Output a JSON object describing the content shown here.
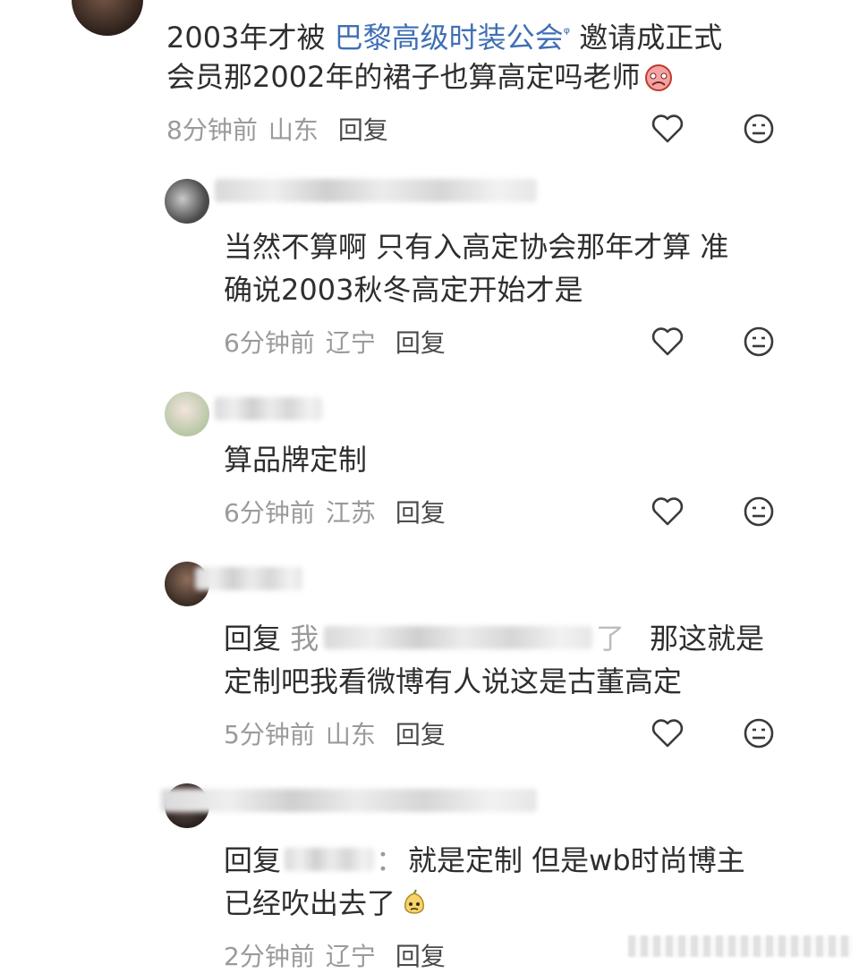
{
  "comments": [
    {
      "text_pre": "2003年才被 ",
      "link": "巴黎高级时装公会",
      "link_mark": "ᵠ",
      "text_post": " 邀请成正式",
      "line2": "会员那2002年的裙子也算高定吗老师",
      "time": "8分钟前",
      "location": "山东",
      "reply": "回复"
    },
    {
      "line1": "当然不算啊 只有入高定协会那年才算 准",
      "line2": "确说2003秋冬高定开始才是",
      "time": "6分钟前",
      "location": "辽宁",
      "reply": "回复"
    },
    {
      "line1": "算品牌定制",
      "time": "6分钟前",
      "location": "江苏",
      "reply": "回复"
    },
    {
      "reply_prefix": "回复",
      "mention_start": "我",
      "mention_end": "了",
      "line1_tail": "那这就是",
      "line2": "定制吧我看微博有人说这是古董高定",
      "time": "5分钟前",
      "location": "山东",
      "reply": "回复"
    },
    {
      "reply_prefix": "回复",
      "colon": "：",
      "line1_tail": "就是定制 但是wb时尚博主",
      "line2": "已经吹出去了",
      "time": "2分钟前",
      "location": "辽宁",
      "reply": "回复"
    }
  ],
  "icons": {
    "like": "heart-outline-icon",
    "dislike": "neutral-face-icon"
  }
}
